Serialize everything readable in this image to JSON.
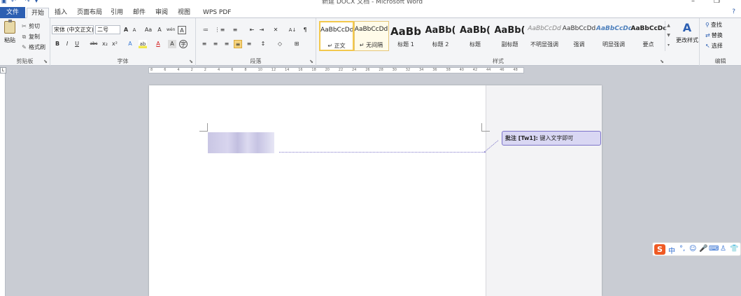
{
  "window": {
    "title": "新建 DOCX 文档 - Microsoft Word",
    "quick_access": [
      "save-icon",
      "undo-icon",
      "redo-icon",
      "customize-icon"
    ],
    "controls": [
      "minimize-icon",
      "restore-icon"
    ]
  },
  "tabs": {
    "file": "文件",
    "items": [
      "开始",
      "插入",
      "页面布局",
      "引用",
      "邮件",
      "审阅",
      "视图",
      "WPS PDF"
    ],
    "active": "开始"
  },
  "clipboard": {
    "paste": "粘贴",
    "cut": "剪切",
    "copy": "复制",
    "format_painter": "格式刷",
    "group_label": "剪贴板"
  },
  "font": {
    "name": "宋体 (中文正文)",
    "size": "二号",
    "group_label": "字体",
    "buttons_row1": [
      "A",
      "A",
      "Aa",
      "A",
      "wén",
      "A"
    ],
    "buttons_row2": [
      "B",
      "I",
      "U",
      "abc",
      "x₂",
      "x²",
      "A",
      "ab",
      "A",
      "A",
      "字"
    ]
  },
  "paragraph": {
    "group_label": "段落",
    "row1": [
      "≔",
      "⋮≡",
      "≡",
      "⇤",
      "⇥",
      "✕",
      "A↓",
      "¶"
    ],
    "row2": [
      "≡",
      "≡",
      "≡",
      "≡",
      "≡",
      "↕",
      "◇",
      "⊞"
    ]
  },
  "styles": {
    "group_label": "样式",
    "items": [
      {
        "sample": "AaBbCcDd",
        "name": "正文",
        "size": "9px",
        "weight": "normal",
        "color": "#222"
      },
      {
        "sample": "AaBbCcDd",
        "name": "无间隔",
        "size": "9px",
        "weight": "normal",
        "color": "#222"
      },
      {
        "sample": "AaBb",
        "name": "标题 1",
        "size": "15px",
        "weight": "bold",
        "color": "#222"
      },
      {
        "sample": "AaBb(",
        "name": "标题 2",
        "size": "13px",
        "weight": "bold",
        "color": "#222"
      },
      {
        "sample": "AaBb(",
        "name": "标题",
        "size": "13px",
        "weight": "bold",
        "color": "#222"
      },
      {
        "sample": "AaBb(",
        "name": "副标题",
        "size": "13px",
        "weight": "bold",
        "color": "#222"
      },
      {
        "sample": "AaBbCcDd",
        "name": "不明显强调",
        "size": "9px",
        "weight": "normal",
        "color": "#888"
      },
      {
        "sample": "AaBbCcDd",
        "name": "强调",
        "size": "9px",
        "weight": "normal",
        "color": "#333"
      },
      {
        "sample": "AaBbCcDc",
        "name": "明显强调",
        "size": "9px",
        "weight": "bold",
        "color": "#4f81bd"
      },
      {
        "sample": "AaBbCcDc",
        "name": "要点",
        "size": "9px",
        "weight": "bold",
        "color": "#222"
      }
    ],
    "change_styles": "更改样式"
  },
  "editing": {
    "group_label": "编辑",
    "find": "查找",
    "replace": "替换",
    "select": "选择"
  },
  "ruler": {
    "ticks": [
      "8",
      "6",
      "4",
      "2",
      "2",
      "4",
      "6",
      "8",
      "10",
      "12",
      "14",
      "16",
      "18",
      "20",
      "22",
      "24",
      "26",
      "28",
      "30",
      "32",
      "34",
      "36",
      "38",
      "40",
      "42",
      "44",
      "46",
      "48"
    ]
  },
  "comment": {
    "label": "批注 [Tw1]:",
    "text": "键入文字即可"
  },
  "ime": {
    "logo": "S",
    "lang": "中",
    "icons": [
      "punctuation-icon",
      "emoji-icon",
      "microphone-icon",
      "keyboard-icon",
      "user-icon",
      "skin-icon"
    ]
  }
}
